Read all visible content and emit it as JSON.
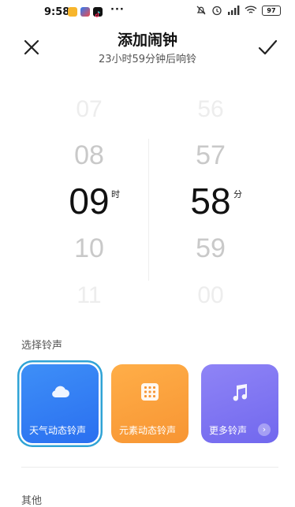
{
  "status_bar": {
    "time": "9:58",
    "more": "···",
    "battery": "97",
    "icons": [
      "app-icon-a",
      "app-icon-b",
      "tiktok-icon",
      "mute-icon",
      "alarm-icon",
      "signal-icon",
      "wifi-icon",
      "battery-icon"
    ]
  },
  "header": {
    "title": "添加闹钟",
    "subtitle": "23小时59分钟后响铃",
    "close_icon": "close-icon",
    "confirm_icon": "check-icon"
  },
  "time_picker": {
    "hours": {
      "faded_prev2": "07",
      "prev": "08",
      "selected": "09",
      "next": "10",
      "faded_next2": "11",
      "unit": "时"
    },
    "minutes": {
      "faded_prev2": "56",
      "prev": "57",
      "selected": "58",
      "next": "59",
      "faded_next2": "00",
      "unit": "分"
    }
  },
  "ringtone": {
    "section_label": "选择铃声",
    "options": [
      {
        "label": "天气动态铃声",
        "icon": "cloud-icon",
        "color": "#3385f4",
        "selected": true
      },
      {
        "label": "元素动态铃声",
        "icon": "grid-icon",
        "color": "#fca23e",
        "selected": false
      },
      {
        "label": "更多铃声",
        "icon": "music-note-icon",
        "color": "#7f76f2",
        "selected": false
      }
    ],
    "more_chevron": "›"
  },
  "other": {
    "section_label": "其他"
  }
}
